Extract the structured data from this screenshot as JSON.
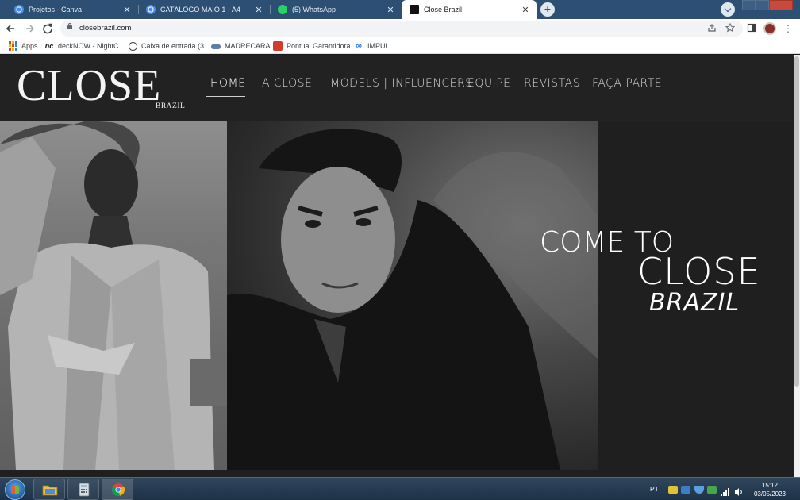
{
  "browser": {
    "tabs": [
      {
        "title": "Projetos - Canva",
        "favicon": "chrome-icon",
        "active": false
      },
      {
        "title": "CATÁLOGO MAIO 1 - A4",
        "favicon": "chrome-icon",
        "active": false
      },
      {
        "title": "(5) WhatsApp",
        "favicon": "whatsapp-icon",
        "active": false
      },
      {
        "title": "Close Brazil",
        "favicon": "close-brazil-icon",
        "active": true
      }
    ],
    "close_glyph": "✕",
    "new_tab_glyph": "+",
    "url": "closebrazil.com",
    "bookmarks": [
      {
        "label": "Apps",
        "icon": "apps-grid-icon"
      },
      {
        "label": "deckNOW - NightC...",
        "icon": "decknow-icon"
      },
      {
        "label": "Caixa de entrada (3...",
        "icon": "mail-icon"
      },
      {
        "label": "MADRECARA",
        "icon": "hat-icon"
      },
      {
        "label": "Pontual Garantidora",
        "icon": "pontual-icon"
      },
      {
        "label": "IMPUL",
        "icon": "meta-icon"
      }
    ]
  },
  "site": {
    "logo": "CLOSE",
    "logo_sub": "BRAZIL",
    "menu": [
      {
        "label": "HOME",
        "current": true
      },
      {
        "label": "A CLOSE",
        "current": false
      },
      {
        "label": "MODELS | INFLUENCERS",
        "current": false
      },
      {
        "label": "EQUIPE",
        "current": false
      },
      {
        "label": "REVISTAS",
        "current": false
      },
      {
        "label": "FAÇA PARTE",
        "current": false
      }
    ],
    "hero": {
      "line1": "COME TO",
      "line2": "CLOSE",
      "line3": "BRAZIL"
    }
  },
  "taskbar": {
    "language": "PT",
    "time": "15:12",
    "date": "03/05/2023",
    "pinned": [
      "windows-explorer-icon",
      "calculator-icon",
      "chrome-icon"
    ]
  },
  "colors": {
    "tabstrip": "#2d4f73",
    "site_header": "#222222",
    "accent_whatsapp": "#25d366"
  }
}
